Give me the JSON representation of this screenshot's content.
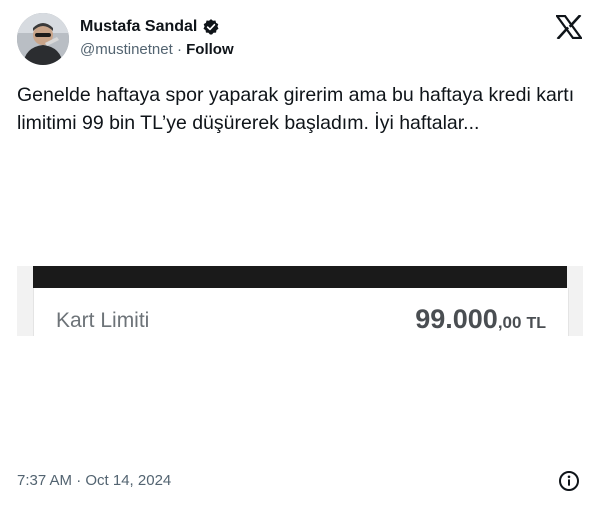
{
  "author": {
    "display_name": "Mustafa Sandal",
    "handle": "@mustinetnet",
    "separator": "·",
    "follow_label": "Follow",
    "verified_icon": "verified-badge-icon"
  },
  "logo_icon": "x-logo-icon",
  "tweet": {
    "text": "Genelde haftaya spor yaparak girerim ama bu haftaya kredi kartı limitimi 99 bin TL’ye düşürerek başladım. İyi haftalar..."
  },
  "media": {
    "label": "Kart Limiti",
    "amount_main": "99.000",
    "amount_cents": ",00",
    "currency": "TL"
  },
  "footer": {
    "timestamp": "7:37 AM · Oct 14, 2024",
    "info_icon": "info-icon"
  },
  "colors": {
    "text_primary": "#0f1419",
    "text_secondary": "#536471",
    "media_topbar": "#1a1a1a"
  }
}
